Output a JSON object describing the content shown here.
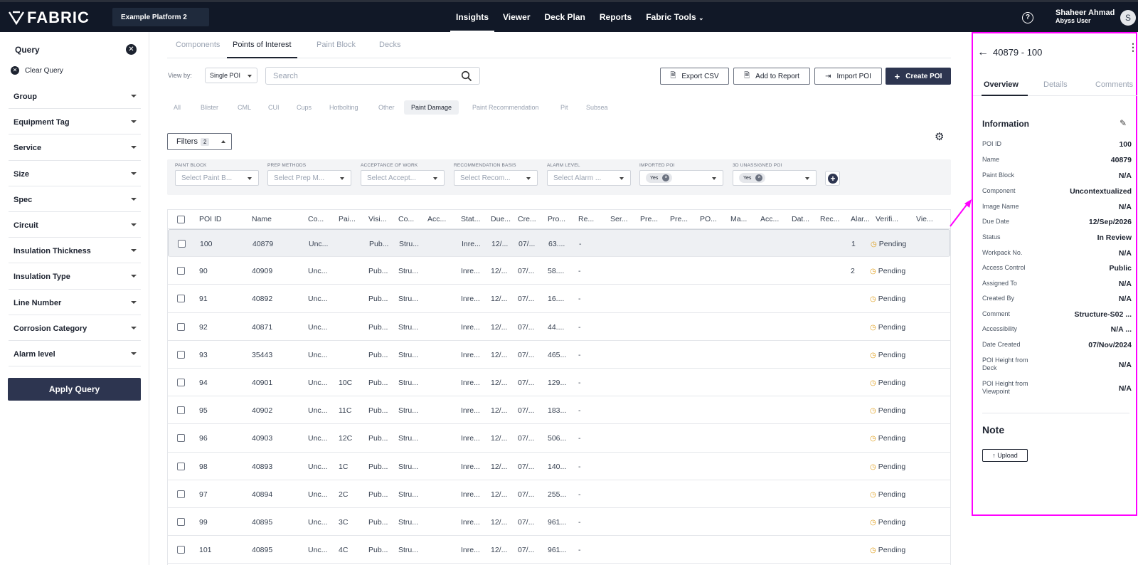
{
  "app": {
    "logo": "FABRIC",
    "platform": "Example Platform 2"
  },
  "nav": {
    "items": [
      "Insights",
      "Viewer",
      "Deck Plan",
      "Reports",
      "Fabric Tools"
    ],
    "active": "Insights"
  },
  "user": {
    "name": "Shaheer Ahmad",
    "role": "Abyss User",
    "initial": "S"
  },
  "sidebar": {
    "title": "Query",
    "clear_label": "Clear Query",
    "items": [
      "Group",
      "Equipment Tag",
      "Service",
      "Size",
      "Spec",
      "Circuit",
      "Insulation Thickness",
      "Insulation Type",
      "Line Number",
      "Corrosion Category",
      "Alarm level"
    ],
    "apply_label": "Apply Query"
  },
  "tabs": [
    "Components",
    "Points of Interest",
    "Paint Block",
    "Decks"
  ],
  "toolbar": {
    "view_by_label": "View by:",
    "view_by_value": "Single POI",
    "search_placeholder": "Search",
    "export_label": "Export CSV",
    "add_report_label": "Add to Report",
    "import_label": "Import POI",
    "create_label": "Create POI"
  },
  "categories": [
    "All",
    "Blister",
    "CML",
    "CUI",
    "Cups",
    "Hotbolting",
    "Other",
    "Paint Damage",
    "Paint Recommendation",
    "Pit",
    "Subsea"
  ],
  "active_category": "Paint Damage",
  "filters": {
    "label": "Filters",
    "count": "2",
    "fields": [
      {
        "label": "PAINT BLOCK",
        "placeholder": "Select Paint B..."
      },
      {
        "label": "PREP METHODS",
        "placeholder": "Select Prep M..."
      },
      {
        "label": "ACCEPTANCE OF WORK",
        "placeholder": "Select Accept..."
      },
      {
        "label": "RECOMMENDATION BASIS",
        "placeholder": "Select Recom..."
      },
      {
        "label": "ALARM LEVEL",
        "placeholder": "Select Alarm ..."
      },
      {
        "label": "IMPORTED POI",
        "chip": "Yes"
      },
      {
        "label": "3D UNASSIGNED POI",
        "chip": "Yes"
      }
    ]
  },
  "table": {
    "headers": [
      "POI ID",
      "Name",
      "Co...",
      "Pai...",
      "Visi...",
      "Co...",
      "Acc...",
      "Stat...",
      "Due...",
      "Cre...",
      "Pro...",
      "Re...",
      "Ser...",
      "Pre...",
      "Pre...",
      "PO...",
      "Ma...",
      "Acc...",
      "Dat...",
      "Rec...",
      "Alar...",
      "Verifi...",
      "Vie..."
    ],
    "rows": [
      {
        "id": "100",
        "name": "40879",
        "co": "Unc...",
        "pai": "",
        "vis": "Pub...",
        "co2": "Stru...",
        "stat": "Inre...",
        "due": "12/...",
        "cre": "07/...",
        "pro": "63....",
        "re": "-",
        "alarm": "1",
        "verif": "Pending"
      },
      {
        "id": "90",
        "name": "40909",
        "co": "Unc...",
        "pai": "",
        "vis": "Pub...",
        "co2": "Stru...",
        "stat": "Inre...",
        "due": "12/...",
        "cre": "07/...",
        "pro": "58....",
        "re": "-",
        "alarm": "2",
        "verif": "Pending"
      },
      {
        "id": "91",
        "name": "40892",
        "co": "Unc...",
        "pai": "",
        "vis": "Pub...",
        "co2": "Stru...",
        "stat": "Inre...",
        "due": "12/...",
        "cre": "07/...",
        "pro": "16....",
        "re": "-",
        "alarm": "",
        "verif": "Pending"
      },
      {
        "id": "92",
        "name": "40871",
        "co": "Unc...",
        "pai": "",
        "vis": "Pub...",
        "co2": "Stru...",
        "stat": "Inre...",
        "due": "12/...",
        "cre": "07/...",
        "pro": "44....",
        "re": "-",
        "alarm": "",
        "verif": "Pending"
      },
      {
        "id": "93",
        "name": "35443",
        "co": "Unc...",
        "pai": "",
        "vis": "Pub...",
        "co2": "Stru...",
        "stat": "Inre...",
        "due": "12/...",
        "cre": "07/...",
        "pro": "465...",
        "re": "-",
        "alarm": "",
        "verif": "Pending"
      },
      {
        "id": "94",
        "name": "40901",
        "co": "Unc...",
        "pai": "10C",
        "vis": "Pub...",
        "co2": "Stru...",
        "stat": "Inre...",
        "due": "12/...",
        "cre": "07/...",
        "pro": "129...",
        "re": "-",
        "alarm": "",
        "verif": "Pending"
      },
      {
        "id": "95",
        "name": "40902",
        "co": "Unc...",
        "pai": "11C",
        "vis": "Pub...",
        "co2": "Stru...",
        "stat": "Inre...",
        "due": "12/...",
        "cre": "07/...",
        "pro": "183...",
        "re": "-",
        "alarm": "",
        "verif": "Pending"
      },
      {
        "id": "96",
        "name": "40903",
        "co": "Unc...",
        "pai": "12C",
        "vis": "Pub...",
        "co2": "Stru...",
        "stat": "Inre...",
        "due": "12/...",
        "cre": "07/...",
        "pro": "506...",
        "re": "-",
        "alarm": "",
        "verif": "Pending"
      },
      {
        "id": "98",
        "name": "40893",
        "co": "Unc...",
        "pai": "1C",
        "vis": "Pub...",
        "co2": "Stru...",
        "stat": "Inre...",
        "due": "12/...",
        "cre": "07/...",
        "pro": "140...",
        "re": "-",
        "alarm": "",
        "verif": "Pending"
      },
      {
        "id": "97",
        "name": "40894",
        "co": "Unc...",
        "pai": "2C",
        "vis": "Pub...",
        "co2": "Stru...",
        "stat": "Inre...",
        "due": "12/...",
        "cre": "07/...",
        "pro": "255...",
        "re": "-",
        "alarm": "",
        "verif": "Pending"
      },
      {
        "id": "99",
        "name": "40895",
        "co": "Unc...",
        "pai": "3C",
        "vis": "Pub...",
        "co2": "Stru...",
        "stat": "Inre...",
        "due": "12/...",
        "cre": "07/...",
        "pro": "961...",
        "re": "-",
        "alarm": "",
        "verif": "Pending"
      },
      {
        "id": "101",
        "name": "40895",
        "co": "Unc...",
        "pai": "4C",
        "vis": "Pub...",
        "co2": "Stru...",
        "stat": "Inre...",
        "due": "12/...",
        "cre": "07/...",
        "pro": "961...",
        "re": "-",
        "alarm": "",
        "verif": "Pending"
      }
    ]
  },
  "panel": {
    "title": "40879 - 100",
    "tabs": [
      "Overview",
      "Details",
      "Comments"
    ],
    "info_title": "Information",
    "fields": [
      {
        "k": "POI ID",
        "v": "100"
      },
      {
        "k": "Name",
        "v": "40879"
      },
      {
        "k": "Paint Block",
        "v": "N/A"
      },
      {
        "k": "Component",
        "v": "Uncontextualized"
      },
      {
        "k": "Image Name",
        "v": "N/A"
      },
      {
        "k": "Due Date",
        "v": "12/Sep/2026"
      },
      {
        "k": "Status",
        "v": "In Review"
      },
      {
        "k": "Workpack No.",
        "v": "N/A"
      },
      {
        "k": "Access Control",
        "v": "Public"
      },
      {
        "k": "Assigned To",
        "v": "N/A"
      },
      {
        "k": "Created By",
        "v": "N/A"
      },
      {
        "k": "Comment",
        "v": "Structure-S02 ..."
      },
      {
        "k": "Accessibility",
        "v": "N/A ..."
      },
      {
        "k": "Date Created",
        "v": "07/Nov/2024"
      },
      {
        "k": "POI Height from Deck",
        "v": "N/A"
      },
      {
        "k": "POI Height from Viewpoint",
        "v": "N/A"
      }
    ],
    "note_title": "Note",
    "upload_label": "Upload"
  },
  "colors": {
    "topbar": "#111827",
    "primary": "#2d3550",
    "highlight": "#ff00ff",
    "pending_icon": "#e0a020"
  }
}
